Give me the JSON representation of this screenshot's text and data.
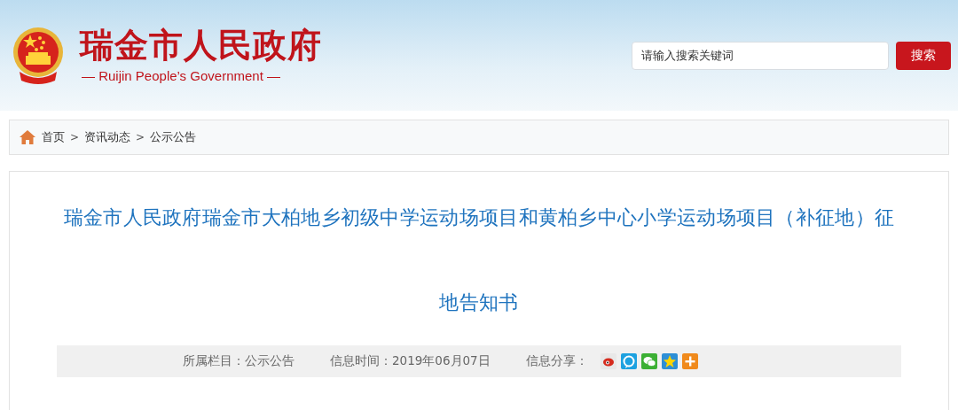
{
  "header": {
    "site_title": "瑞金市人民政府",
    "site_subtitle": "— Ruijin People’s Government —",
    "search": {
      "placeholder": "请输入搜索关键词",
      "button": "搜索"
    }
  },
  "breadcrumb": [
    {
      "label": "首页"
    },
    {
      "label": ">",
      "kind": "separator"
    },
    {
      "label": "资讯动态"
    },
    {
      "label": ">",
      "kind": "separator"
    },
    {
      "label": "公示公告"
    }
  ],
  "article": {
    "title": "瑞金市人民政府瑞金市大柏地乡初级中学运动场项目和黄柏乡中心小学运动场项目（补征地）征地告知书",
    "meta": [
      {
        "label": "所属栏目：公示公告"
      },
      {
        "label": "信息时间：2019年06月07日"
      },
      {
        "label": "信息分享："
      }
    ],
    "share": [
      {
        "kind": "weibo",
        "color": "#e8e8e8"
      },
      {
        "kind": "tencent",
        "color": "#1da1e0"
      },
      {
        "kind": "wechat",
        "color": "#3cb034"
      },
      {
        "kind": "qzone",
        "color": "#2d8fd6"
      },
      {
        "kind": "more",
        "color": "#f08a1c"
      }
    ]
  }
}
